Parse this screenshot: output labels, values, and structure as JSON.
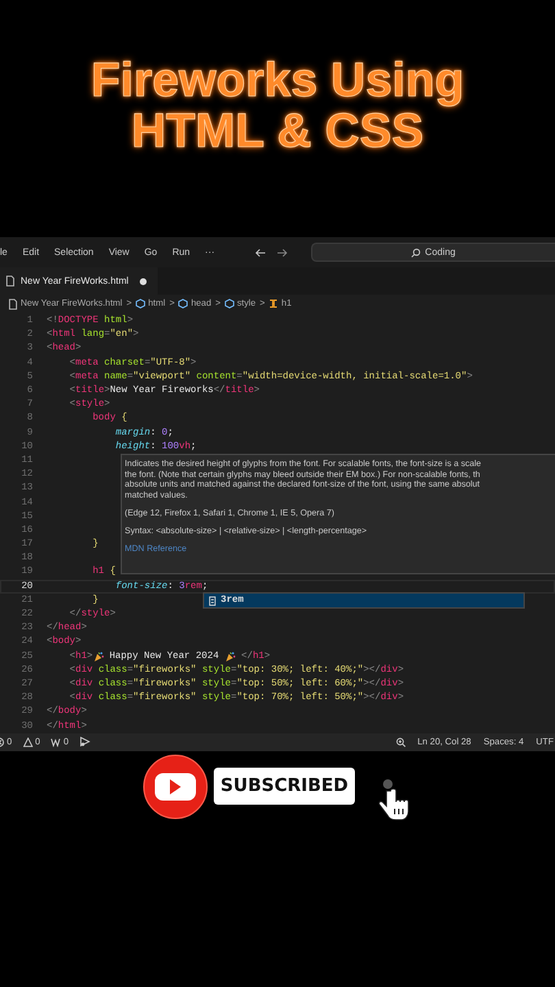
{
  "video_title": [
    "Fireworks Using",
    "HTML & CSS"
  ],
  "menu_bar": {
    "items": [
      "le",
      "Edit",
      "Selection",
      "View",
      "Go",
      "Run",
      "···"
    ],
    "search": {
      "value": "Coding"
    }
  },
  "tabs": [
    {
      "label": "New Year FireWorks.html",
      "selected": true,
      "modified": true
    }
  ],
  "breadcrumbs": [
    {
      "kind": "file",
      "label": "New Year FireWorks.html"
    },
    {
      "kind": "symbol",
      "label": "html"
    },
    {
      "kind": "symbol",
      "label": "head"
    },
    {
      "kind": "symbol",
      "label": "style"
    },
    {
      "kind": "element",
      "label": "h1"
    }
  ],
  "breadcrumb_separator": ">",
  "editor": {
    "lines": [
      {
        "number": "1",
        "tokens": [
          {
            "kind": "punct",
            "text": "<!"
          },
          {
            "kind": "tag",
            "text": "DOCTYPE"
          },
          {
            "kind": "attr",
            "text": " html"
          },
          {
            "kind": "punct",
            "text": ">"
          }
        ]
      },
      {
        "number": "2",
        "tokens": [
          {
            "kind": "punct",
            "text": "<"
          },
          {
            "kind": "tag",
            "text": "html"
          },
          {
            "kind": "attr",
            "text": " lang"
          },
          {
            "kind": "punct",
            "text": "="
          },
          {
            "kind": "string",
            "text": "\"en\""
          },
          {
            "kind": "punct",
            "text": ">"
          }
        ]
      },
      {
        "number": "3",
        "tokens": [
          {
            "kind": "punct",
            "text": "<"
          },
          {
            "kind": "tag",
            "text": "head"
          },
          {
            "kind": "punct",
            "text": ">"
          }
        ]
      },
      {
        "number": "4",
        "tokens": [
          {
            "kind": "punct",
            "text": "    <"
          },
          {
            "kind": "tag",
            "text": "meta"
          },
          {
            "kind": "attr",
            "text": " charset"
          },
          {
            "kind": "punct",
            "text": "="
          },
          {
            "kind": "string",
            "text": "\"UTF-8\""
          },
          {
            "kind": "punct",
            "text": ">"
          }
        ]
      },
      {
        "number": "5",
        "tokens": [
          {
            "kind": "punct",
            "text": "    <"
          },
          {
            "kind": "tag",
            "text": "meta"
          },
          {
            "kind": "attr",
            "text": " name"
          },
          {
            "kind": "punct",
            "text": "="
          },
          {
            "kind": "string",
            "text": "\"viewport\""
          },
          {
            "kind": "attr",
            "text": " content"
          },
          {
            "kind": "punct",
            "text": "="
          },
          {
            "kind": "string",
            "text": "\"width=device-width, initial-scale=1.0\""
          },
          {
            "kind": "punct",
            "text": ">"
          }
        ]
      },
      {
        "number": "6",
        "tokens": [
          {
            "kind": "punct",
            "text": "    <"
          },
          {
            "kind": "tag",
            "text": "title"
          },
          {
            "kind": "punct",
            "text": ">"
          },
          {
            "kind": "text",
            "text": "New Year Fireworks"
          },
          {
            "kind": "punct",
            "text": "</"
          },
          {
            "kind": "tag",
            "text": "title"
          },
          {
            "kind": "punct",
            "text": ">"
          }
        ]
      },
      {
        "number": "7",
        "tokens": [
          {
            "kind": "punct",
            "text": "    <"
          },
          {
            "kind": "tag",
            "text": "style"
          },
          {
            "kind": "punct",
            "text": ">"
          }
        ]
      },
      {
        "number": "8",
        "tokens": [
          {
            "kind": "selector",
            "text": "        body"
          },
          {
            "kind": "brace",
            "text": " {"
          }
        ]
      },
      {
        "number": "9",
        "tokens": [
          {
            "kind": "prop",
            "text": "            margin"
          },
          {
            "kind": "text",
            "text": ": "
          },
          {
            "kind": "number",
            "text": "0"
          },
          {
            "kind": "text",
            "text": ";"
          }
        ]
      },
      {
        "number": "10",
        "tokens": [
          {
            "kind": "prop",
            "text": "            height"
          },
          {
            "kind": "text",
            "text": ": "
          },
          {
            "kind": "number",
            "text": "100"
          },
          {
            "kind": "unit",
            "text": "vh"
          },
          {
            "kind": "text",
            "text": ";"
          }
        ]
      },
      {
        "number": "11"
      },
      {
        "number": "12"
      },
      {
        "number": "13"
      },
      {
        "number": "14"
      },
      {
        "number": "15"
      },
      {
        "number": "16"
      },
      {
        "number": "17",
        "tokens": [
          {
            "kind": "brace",
            "text": "        }"
          }
        ]
      },
      {
        "number": "18"
      },
      {
        "number": "19",
        "tokens": [
          {
            "kind": "selector",
            "text": "        h1"
          },
          {
            "kind": "brace",
            "text": " {"
          }
        ]
      },
      {
        "number": "20",
        "current": true,
        "tokens": [
          {
            "kind": "prop",
            "text": "            font-size"
          },
          {
            "kind": "text",
            "text": ": "
          },
          {
            "kind": "number",
            "text": "3"
          },
          {
            "kind": "unit",
            "text": "rem"
          },
          {
            "kind": "text",
            "text": ";"
          }
        ]
      },
      {
        "number": "21",
        "tokens": [
          {
            "kind": "brace",
            "text": "        }"
          }
        ]
      },
      {
        "number": "22",
        "tokens": [
          {
            "kind": "punct",
            "text": "    </"
          },
          {
            "kind": "tag",
            "text": "style"
          },
          {
            "kind": "punct",
            "text": ">"
          }
        ]
      },
      {
        "number": "23",
        "tokens": [
          {
            "kind": "punct",
            "text": "</"
          },
          {
            "kind": "tag",
            "text": "head"
          },
          {
            "kind": "punct",
            "text": ">"
          }
        ]
      },
      {
        "number": "24",
        "tokens": [
          {
            "kind": "punct",
            "text": "<"
          },
          {
            "kind": "tag",
            "text": "body"
          },
          {
            "kind": "punct",
            "text": ">"
          }
        ]
      },
      {
        "number": "25",
        "tokens": [
          {
            "kind": "punct",
            "text": "    <"
          },
          {
            "kind": "tag",
            "text": "h1"
          },
          {
            "kind": "punct",
            "text": ">"
          },
          {
            "kind": "icon"
          },
          {
            "kind": "text",
            "text": " Happy New Year 2024 "
          },
          {
            "kind": "icon"
          },
          {
            "kind": "punct",
            "text": " </"
          },
          {
            "kind": "tag",
            "text": "h1"
          },
          {
            "kind": "punct",
            "text": ">"
          }
        ]
      },
      {
        "number": "26",
        "tokens": [
          {
            "kind": "punct",
            "text": "    <"
          },
          {
            "kind": "tag",
            "text": "div"
          },
          {
            "kind": "attr",
            "text": " class"
          },
          {
            "kind": "punct",
            "text": "="
          },
          {
            "kind": "string",
            "text": "\"fireworks\""
          },
          {
            "kind": "attr",
            "text": " style"
          },
          {
            "kind": "punct",
            "text": "="
          },
          {
            "kind": "string",
            "text": "\"top: 30%; left: 40%;\""
          },
          {
            "kind": "punct",
            "text": "></"
          },
          {
            "kind": "tag",
            "text": "div"
          },
          {
            "kind": "punct",
            "text": ">"
          }
        ]
      },
      {
        "number": "27",
        "tokens": [
          {
            "kind": "punct",
            "text": "    <"
          },
          {
            "kind": "tag",
            "text": "div"
          },
          {
            "kind": "attr",
            "text": " class"
          },
          {
            "kind": "punct",
            "text": "="
          },
          {
            "kind": "string",
            "text": "\"fireworks\""
          },
          {
            "kind": "attr",
            "text": " style"
          },
          {
            "kind": "punct",
            "text": "="
          },
          {
            "kind": "string",
            "text": "\"top: 50%; left: 60%;\""
          },
          {
            "kind": "punct",
            "text": "></"
          },
          {
            "kind": "tag",
            "text": "div"
          },
          {
            "kind": "punct",
            "text": ">"
          }
        ]
      },
      {
        "number": "28",
        "tokens": [
          {
            "kind": "punct",
            "text": "    <"
          },
          {
            "kind": "tag",
            "text": "div"
          },
          {
            "kind": "attr",
            "text": " class"
          },
          {
            "kind": "punct",
            "text": "="
          },
          {
            "kind": "string",
            "text": "\"fireworks\""
          },
          {
            "kind": "attr",
            "text": " style"
          },
          {
            "kind": "punct",
            "text": "="
          },
          {
            "kind": "string",
            "text": "\"top: 70%; left: 50%;\""
          },
          {
            "kind": "punct",
            "text": "></"
          },
          {
            "kind": "tag",
            "text": "div"
          },
          {
            "kind": "punct",
            "text": ">"
          }
        ]
      },
      {
        "number": "29",
        "tokens": [
          {
            "kind": "punct",
            "text": "</"
          },
          {
            "kind": "tag",
            "text": "body"
          },
          {
            "kind": "punct",
            "text": ">"
          }
        ]
      },
      {
        "number": "30",
        "tokens": [
          {
            "kind": "punct",
            "text": "</"
          },
          {
            "kind": "tag",
            "text": "html"
          },
          {
            "kind": "punct",
            "text": ">"
          }
        ]
      }
    ]
  },
  "hover": {
    "description": [
      "Indicates the desired height of glyphs from the font. For scalable fonts, the font-size is a scale",
      "the font. (Note that certain glyphs may bleed outside their EM box.) For non-scalable fonts, th",
      "absolute units and matched against the declared font-size of the font, using the same absolut",
      "matched values."
    ],
    "support": "(Edge 12, Firefox 1, Safari 1, Chrome 1, IE 5, Opera 7)",
    "syntax": "Syntax: <absolute-size> | <relative-size> | <length-percentage>",
    "link": "MDN Reference"
  },
  "suggestions": [
    {
      "label": "3rem",
      "selected": true
    }
  ],
  "status_bar": {
    "left": [
      {
        "kind": "error",
        "text": "0"
      },
      {
        "kind": "warning",
        "text": "0"
      },
      {
        "kind": "ports",
        "text": "0"
      },
      {
        "kind": "share"
      }
    ],
    "right": [
      {
        "kind": "zoom"
      },
      {
        "kind": "text",
        "text": "Ln 20, Col 28"
      },
      {
        "kind": "text",
        "text": "Spaces: 4"
      },
      {
        "kind": "text",
        "text": "UTF"
      }
    ]
  },
  "subscribe": {
    "label": "SUBSCRIBED"
  }
}
